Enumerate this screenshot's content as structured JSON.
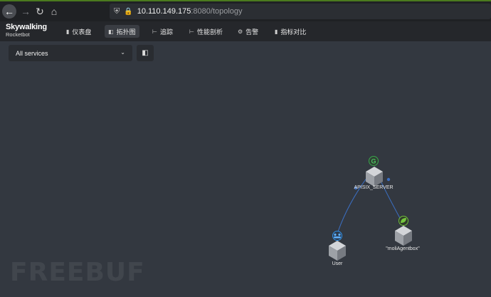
{
  "browser": {
    "url_host": "10.110.149.175",
    "url_path": ":8080/topology",
    "icons": [
      "back-icon",
      "forward-icon",
      "reload-icon",
      "home-icon",
      "shield-icon",
      "insecure-lock-icon"
    ]
  },
  "header": {
    "logo": {
      "brand": "Skywalking",
      "sub": "Rocketbot"
    },
    "menu": [
      {
        "label": "仪表盘",
        "icon": "dashboard-icon",
        "active": false
      },
      {
        "label": "拓扑图",
        "icon": "topology-icon",
        "active": true
      },
      {
        "label": "追踪",
        "icon": "trace-icon",
        "active": false
      },
      {
        "label": "性能剖析",
        "icon": "profile-icon",
        "active": false
      },
      {
        "label": "告警",
        "icon": "alarm-icon",
        "active": false
      },
      {
        "label": "指标对比",
        "icon": "compare-icon",
        "active": false
      }
    ]
  },
  "toolbar": {
    "service_select": "All services"
  },
  "topology": {
    "nodes": [
      {
        "name": "APISIX_SERVER",
        "badge": "G",
        "badge_color": "#3aa64c"
      },
      {
        "name": "User",
        "badge": "user-group-icon",
        "badge_color": "#2f8fe6"
      },
      {
        "name": "\"moliAgentbox\"",
        "badge": "leaf-icon",
        "badge_color": "#6fbf3b"
      }
    ],
    "edges": [
      {
        "from": "User",
        "to": "APISIX_SERVER"
      },
      {
        "from": "APISIX_SERVER",
        "to": "\"moliAgentbox\""
      }
    ],
    "colors": {
      "edge": "#3b6fc2",
      "node_top": "#d6d8dc",
      "node_left": "#9ea2a8",
      "node_right": "#7a7e85"
    }
  },
  "watermark": "FREEBUF"
}
